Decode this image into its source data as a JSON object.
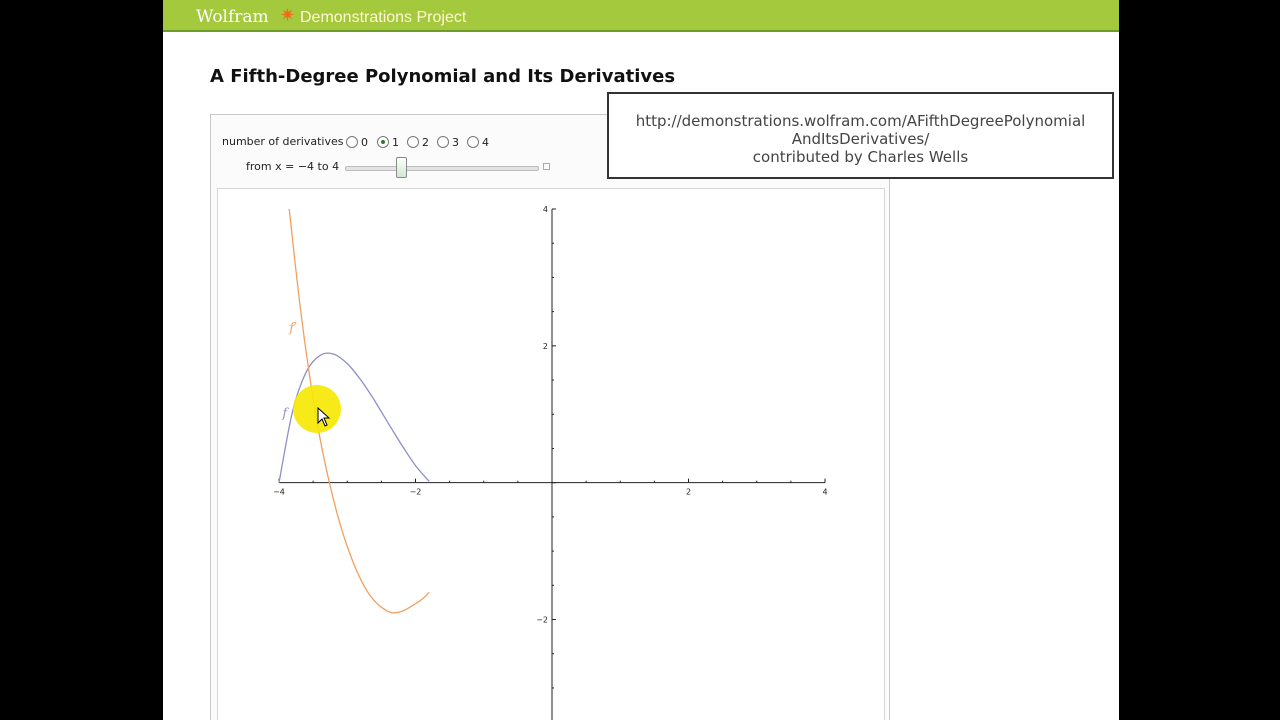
{
  "header": {
    "brand_wolfram": "Wolfram",
    "brand_demo": "Demonstrations Project",
    "colors": {
      "banner": "#a5c93d",
      "spikey": "#f26b1d"
    }
  },
  "title": "A Fifth-Degree Polynomial and Its Derivatives",
  "controls": {
    "derivatives_label": "number of derivatives",
    "derivative_options": [
      "0",
      "1",
      "2",
      "3",
      "4"
    ],
    "selected_derivative": "1",
    "range_label": "from x = −4 to 4",
    "slider_fraction": 0.29
  },
  "url_overlay": {
    "line1": "http://demonstrations.wolfram.com/AFifthDegreePolynomial",
    "line2": "AndItsDerivatives/",
    "line3": "contributed by Charles Wells"
  },
  "chart_data": {
    "type": "line",
    "xlim": [
      -4,
      4
    ],
    "ylim": [
      -3.6,
      4
    ],
    "x_ticks": [
      -4,
      -2,
      2,
      4
    ],
    "x_tick_labels": [
      "−4",
      "−2",
      "2",
      "4"
    ],
    "y_ticks": [
      4,
      2,
      -2
    ],
    "y_tick_labels": [
      "4",
      "2",
      "−2"
    ],
    "grid": false,
    "series": [
      {
        "name": "f",
        "color": "#8f8fc8",
        "x": [
          -4.0,
          -3.8,
          -3.6,
          -3.4,
          -3.2,
          -3.0,
          -2.8,
          -2.6,
          -2.4,
          -2.2,
          -2.0,
          -1.8
        ],
        "y": [
          0.0,
          1.05,
          1.62,
          1.86,
          1.88,
          1.74,
          1.5,
          1.2,
          0.87,
          0.55,
          0.25,
          0.02
        ]
      },
      {
        "name": "f′",
        "color": "#f0a060",
        "x": [
          -3.85,
          -3.7,
          -3.55,
          -3.4,
          -3.25,
          -3.1,
          -2.95,
          -2.8,
          -2.65,
          -2.5,
          -2.35,
          -2.2,
          -2.05,
          -1.9,
          -1.8
        ],
        "y": [
          4.0,
          2.65,
          1.55,
          0.65,
          -0.05,
          -0.62,
          -1.07,
          -1.42,
          -1.67,
          -1.82,
          -1.9,
          -1.88,
          -1.8,
          -1.7,
          -1.6
        ]
      }
    ],
    "curve_labels": [
      {
        "text": "f′",
        "series": "f′",
        "x": -3.85,
        "y": 2.2
      },
      {
        "text": "f",
        "series": "f",
        "x": -3.95,
        "y": 0.95
      }
    ]
  }
}
